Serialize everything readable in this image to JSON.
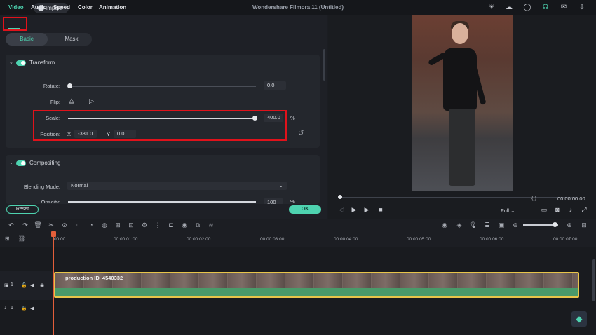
{
  "topbar": {
    "import_label": "Import",
    "title": "Wondershare Filmora 11 (Untitled)",
    "icons": [
      "bulb-icon",
      "cloud-icon",
      "headset-icon",
      "mail-icon",
      "download-icon"
    ]
  },
  "tabs": [
    {
      "label": "Video",
      "active": true
    },
    {
      "label": "Audio"
    },
    {
      "label": "Speed"
    },
    {
      "label": "Color"
    },
    {
      "label": "Animation"
    }
  ],
  "subtabs": {
    "basic": "Basic",
    "mask": "Mask"
  },
  "transform": {
    "title": "Transform",
    "rotate_label": "Rotate:",
    "rotate_value": "0.0",
    "flip_label": "Flip:",
    "scale_label": "Scale:",
    "scale_value": "400.0",
    "scale_unit": "%",
    "position_label": "Position:",
    "x_label": "X",
    "x_value": "-381.0",
    "y_label": "Y",
    "y_value": "0.0"
  },
  "compositing": {
    "title": "Compositing",
    "blend_label": "Blending Mode:",
    "blend_value": "Normal",
    "opacity_label": "Opacity:",
    "opacity_value": "100",
    "opacity_unit": "%"
  },
  "buttons": {
    "reset": "Reset",
    "ok": "OK"
  },
  "preview": {
    "timecode": "00:00:00:00",
    "quality": "Full",
    "brackets": "{     }"
  },
  "timeline": {
    "ticks": [
      "00:00",
      "00:00:01:00",
      "00:00:02:00",
      "00:00:03:00",
      "00:00:04:00",
      "00:00:05:00",
      "00:00:06:00",
      "00:00:07:00"
    ],
    "clip_name": "production ID_4540332",
    "video_track": "1",
    "audio_track": "1"
  }
}
